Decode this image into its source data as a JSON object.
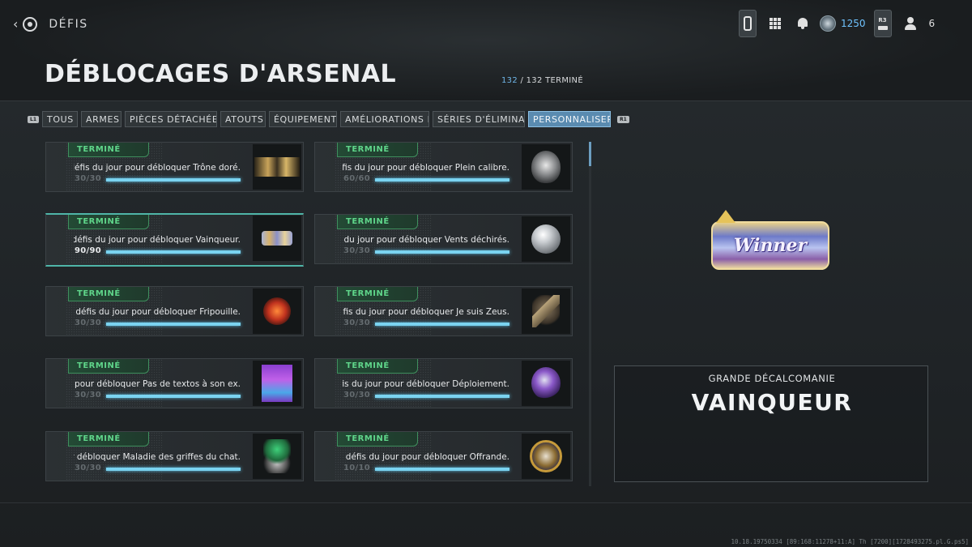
{
  "header": {
    "breadcrumb": "DÉFIS",
    "currency": "1250",
    "party_count": "6",
    "r3_label": "R3",
    "back_icon": "back-circle-icon"
  },
  "page": {
    "title": "DÉBLOCAGES D'ARSENAL",
    "progress_done": "132",
    "progress_rest": " / 132 TERMINÉ"
  },
  "tabs": {
    "left_hint": "L1",
    "right_hint": "R1",
    "items": [
      {
        "label": "TOUS"
      },
      {
        "label": "ARMES"
      },
      {
        "label": "PIÈCES DÉTACHÉES"
      },
      {
        "label": "ATOUTS"
      },
      {
        "label": "ÉQUIPEMENT"
      },
      {
        "label": "AMÉLIORATIONS D"
      },
      {
        "label": "SÉRIES D'ÉLIMINA"
      },
      {
        "label": "PERSONNALISER"
      }
    ],
    "active": "PERSONNALISER"
  },
  "challenges": [
    {
      "status": "TERMINÉ",
      "text": "défis du jour pour débloquer Trône doré.",
      "count": "30/30",
      "progress": 1.0,
      "icon": "trone-dore-decal"
    },
    {
      "status": "TERMINÉ",
      "text": "éfis du jour pour débloquer Plein calibre.",
      "count": "60/60",
      "progress": 1.0,
      "icon": "plein-calibre-emblem"
    },
    {
      "status": "TERMINÉ",
      "text": "l défis du jour pour débloquer Vainqueur.",
      "count": "90/90",
      "progress": 1.0,
      "icon": "vainqueur-decal",
      "selected": true
    },
    {
      "status": "TERMINÉ",
      "text": "s du jour pour débloquer Vents déchirés.",
      "count": "30/30",
      "progress": 1.0,
      "icon": "vents-dechires-emblem"
    },
    {
      "status": "TERMINÉ",
      "text": "0 défis du jour pour débloquer Fripouille.",
      "count": "30/30",
      "progress": 1.0,
      "icon": "fripouille-emblem"
    },
    {
      "status": "TERMINÉ",
      "text": "défis du jour pour débloquer Je suis Zeus.",
      "count": "30/30",
      "progress": 1.0,
      "icon": "je-suis-zeus-emblem"
    },
    {
      "status": "TERMINÉ",
      "text": "r pour débloquer Pas de textos à son ex.",
      "count": "30/30",
      "progress": 1.0,
      "icon": "pas-de-textos-emblem"
    },
    {
      "status": "TERMINÉ",
      "text": "éfis du jour pour débloquer Déploiement.",
      "count": "30/30",
      "progress": 1.0,
      "icon": "deploiement-emblem"
    },
    {
      "status": "TERMINÉ",
      "text": "r débloquer Maladie des griffes du chat.",
      "count": "30/30",
      "progress": 1.0,
      "icon": "maladie-griffes-emblem"
    },
    {
      "status": "TERMINÉ",
      "text": "0 défis du jour pour débloquer Offrande.",
      "count": "10/10",
      "progress": 1.0,
      "icon": "offrande-emblem"
    }
  ],
  "detail": {
    "type": "GRANDE DÉCALCOMANIE",
    "name": "VAINQUEUR",
    "preview_text": "Winner"
  },
  "footer": {
    "build": "10.18.19750334 [89:168:11278+11:A] Th [7200][1728493275.pl.G.ps5]"
  },
  "colors": {
    "accent_blue": "#7ad3f0",
    "badge_green": "#5fd58a",
    "selected_border": "#4fb5a8",
    "tab_active": "#5a8bb0",
    "currency": "#6fc3ff"
  }
}
